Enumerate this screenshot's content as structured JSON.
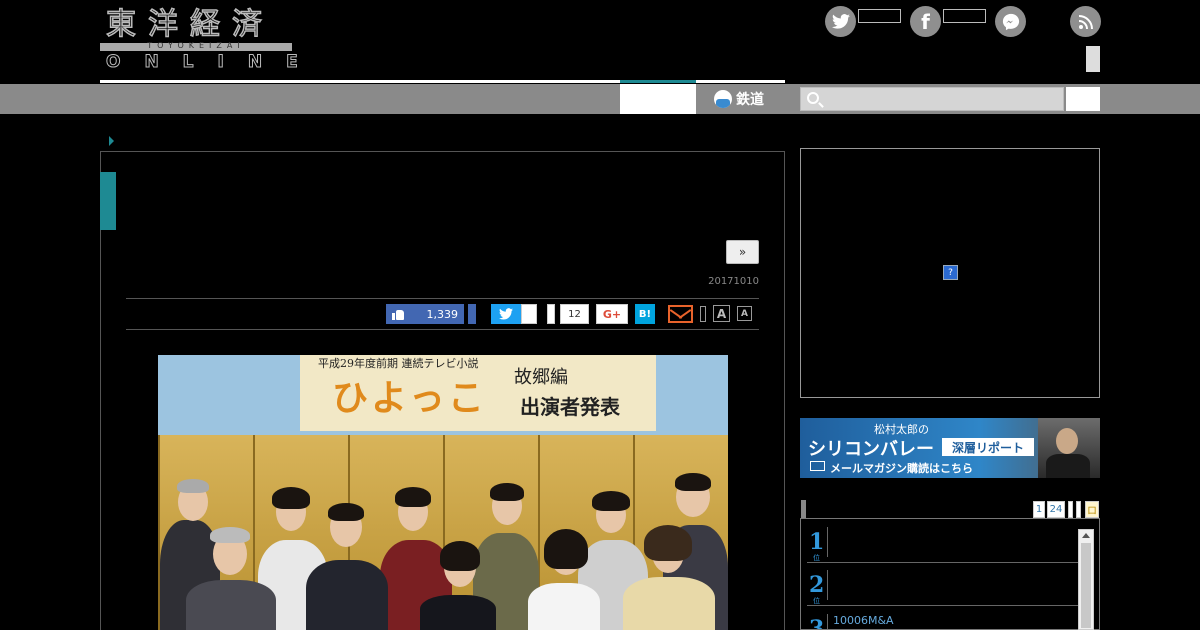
{
  "header": {
    "logo_kanji": "東洋経済",
    "logo_roman": "TOYOKEIZAI",
    "logo_online": "ONLINE",
    "social_icons": [
      "twitter-icon",
      "facebook-icon",
      "messenger-icon",
      "rss-icon"
    ]
  },
  "nav": {
    "railway_label": "鉄道",
    "search_placeholder": ""
  },
  "article": {
    "next_label": "»",
    "date": "20171010",
    "share": {
      "like_count": "1,339",
      "misc_count": "12",
      "gplus_label": "G+",
      "hatena_label": "B!",
      "font_large": "A",
      "font_small": "A"
    },
    "photo": {
      "sign_top": "平成29年度前期 連続テレビ小説",
      "sign_title": "ひよっこ",
      "sign_sub1": "故郷編",
      "sign_sub2": "出演者発表"
    }
  },
  "sidebar": {
    "ad_badge": "?",
    "banner": {
      "small_text": "松村太郎の",
      "big_text": "シリコンバレー",
      "tag": "深層リポート",
      "mail_text": "メールマガジン購読はこちら"
    },
    "ranking": {
      "tabs": [
        "1",
        "24",
        "",
        "",
        "ロ"
      ],
      "items": [
        {
          "num": "1",
          "suffix": "位",
          "text": ""
        },
        {
          "num": "2",
          "suffix": "位",
          "text": ""
        },
        {
          "num": "3",
          "suffix": "位",
          "text": "10006M&A"
        }
      ]
    }
  },
  "colors": {
    "accent": "#1e8a93",
    "nav_bg": "#8a8a8a",
    "facebook": "#4267b2",
    "twitter": "#1da1f2",
    "hatena": "#00a4de",
    "mail": "#e8632b",
    "rank": "#3399dd"
  }
}
